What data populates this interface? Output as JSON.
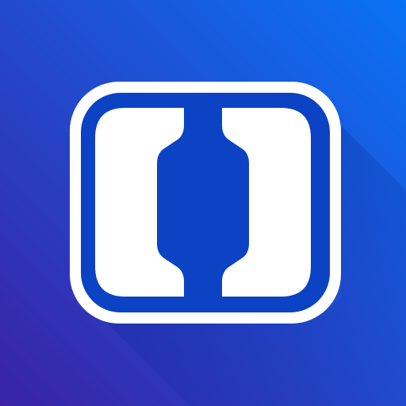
{
  "icon": {
    "name": "app-logo-icon",
    "colors": {
      "gradient_top_right": "#0a72f5",
      "gradient_bottom_left": "#3a22a6",
      "frame": "#ffffff",
      "inner_plate": "#0c42c4",
      "shadow": "#0c2a9a"
    }
  }
}
